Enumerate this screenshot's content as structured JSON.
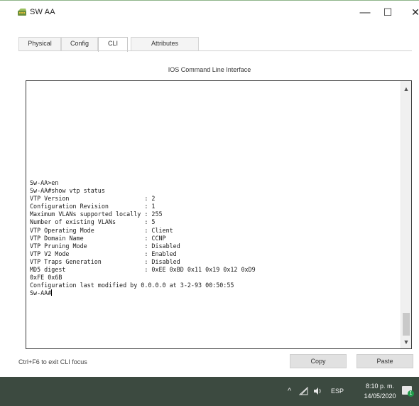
{
  "window": {
    "title": "SW AA",
    "minimize_glyph": "—",
    "maximize_glyph": "☐",
    "close_glyph": "✕"
  },
  "tabs": [
    {
      "label": "Physical",
      "active": false
    },
    {
      "label": "Config",
      "active": false
    },
    {
      "label": "CLI",
      "active": true
    },
    {
      "label": "Attributes",
      "active": false
    }
  ],
  "panel_title": "IOS Command Line Interface",
  "terminal": {
    "lines": [
      "Sw-AA>en",
      "Sw-AA#show vtp status",
      "VTP Version                     : 2",
      "Configuration Revision          : 1",
      "Maximum VLANs supported locally : 255",
      "Number of existing VLANs        : 5",
      "VTP Operating Mode              : Client",
      "VTP Domain Name                 : CCNP",
      "VTP Pruning Mode                : Disabled",
      "VTP V2 Mode                     : Enabled",
      "VTP Traps Generation            : Disabled",
      "MD5 digest                      : 0xEE 0xBD 0x11 0x19 0x12 0xD9",
      "0xFE 0x6B",
      "Configuration last modified by 0.0.0.0 at 3-2-93 00:50:55",
      "Sw-AA#"
    ]
  },
  "footer": {
    "hint": "Ctrl+F6 to exit CLI focus",
    "copy_label": "Copy",
    "paste_label": "Paste"
  },
  "taskbar": {
    "language": "ESP",
    "time": "8:10 p. m.",
    "date": "14/05/2020",
    "notification_count": "1"
  },
  "colors": {
    "taskbar_bg": "#3c4a40",
    "badge": "#1e9d4a"
  }
}
